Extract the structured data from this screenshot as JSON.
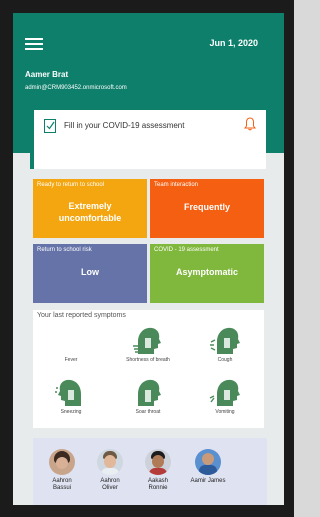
{
  "header": {
    "date": "Jun 1, 2020",
    "user_name": "Aamer Brat",
    "user_email": "admin@CRM903452.onmicrosoft.com"
  },
  "assessment": {
    "label": "Fill in your COVID-19 assessment"
  },
  "tiles": [
    {
      "label": "Ready to return to school",
      "value_line1": "Extremely",
      "value_line2": "uncomfortable",
      "color": "#f4a610"
    },
    {
      "label": "Team interaction",
      "value": "Frequently",
      "color": "#f55f12"
    },
    {
      "label": "Return to school risk",
      "value": "Low",
      "color": "#6673a8"
    },
    {
      "label": "COVID - 19 assessment",
      "value": "Asymptomatic",
      "color": "#80b73d"
    }
  ],
  "symptoms": {
    "title": "Your last reported symptoms",
    "items": [
      {
        "label": "Fever",
        "icon": "fever-icon"
      },
      {
        "label": "Shortness of breath",
        "icon": "breath-icon"
      },
      {
        "label": "Cough",
        "icon": "cough-icon"
      },
      {
        "label": "Sneezing",
        "icon": "sneezing-icon"
      },
      {
        "label": "Soar throat",
        "icon": "sore-throat-icon"
      },
      {
        "label": "Vomiting",
        "icon": "vomiting-icon"
      }
    ]
  },
  "people": [
    {
      "name_line1": "Aahron",
      "name_line2": "Bassui"
    },
    {
      "name_line1": "Aahron",
      "name_line2": "Oliver"
    },
    {
      "name_line1": "Aakash",
      "name_line2": "Ronnie"
    },
    {
      "name_line1": "Aamir James",
      "name_line2": ""
    }
  ],
  "colors": {
    "header": "#0e7f6b",
    "symptom_icon": "#4a8a5a"
  }
}
